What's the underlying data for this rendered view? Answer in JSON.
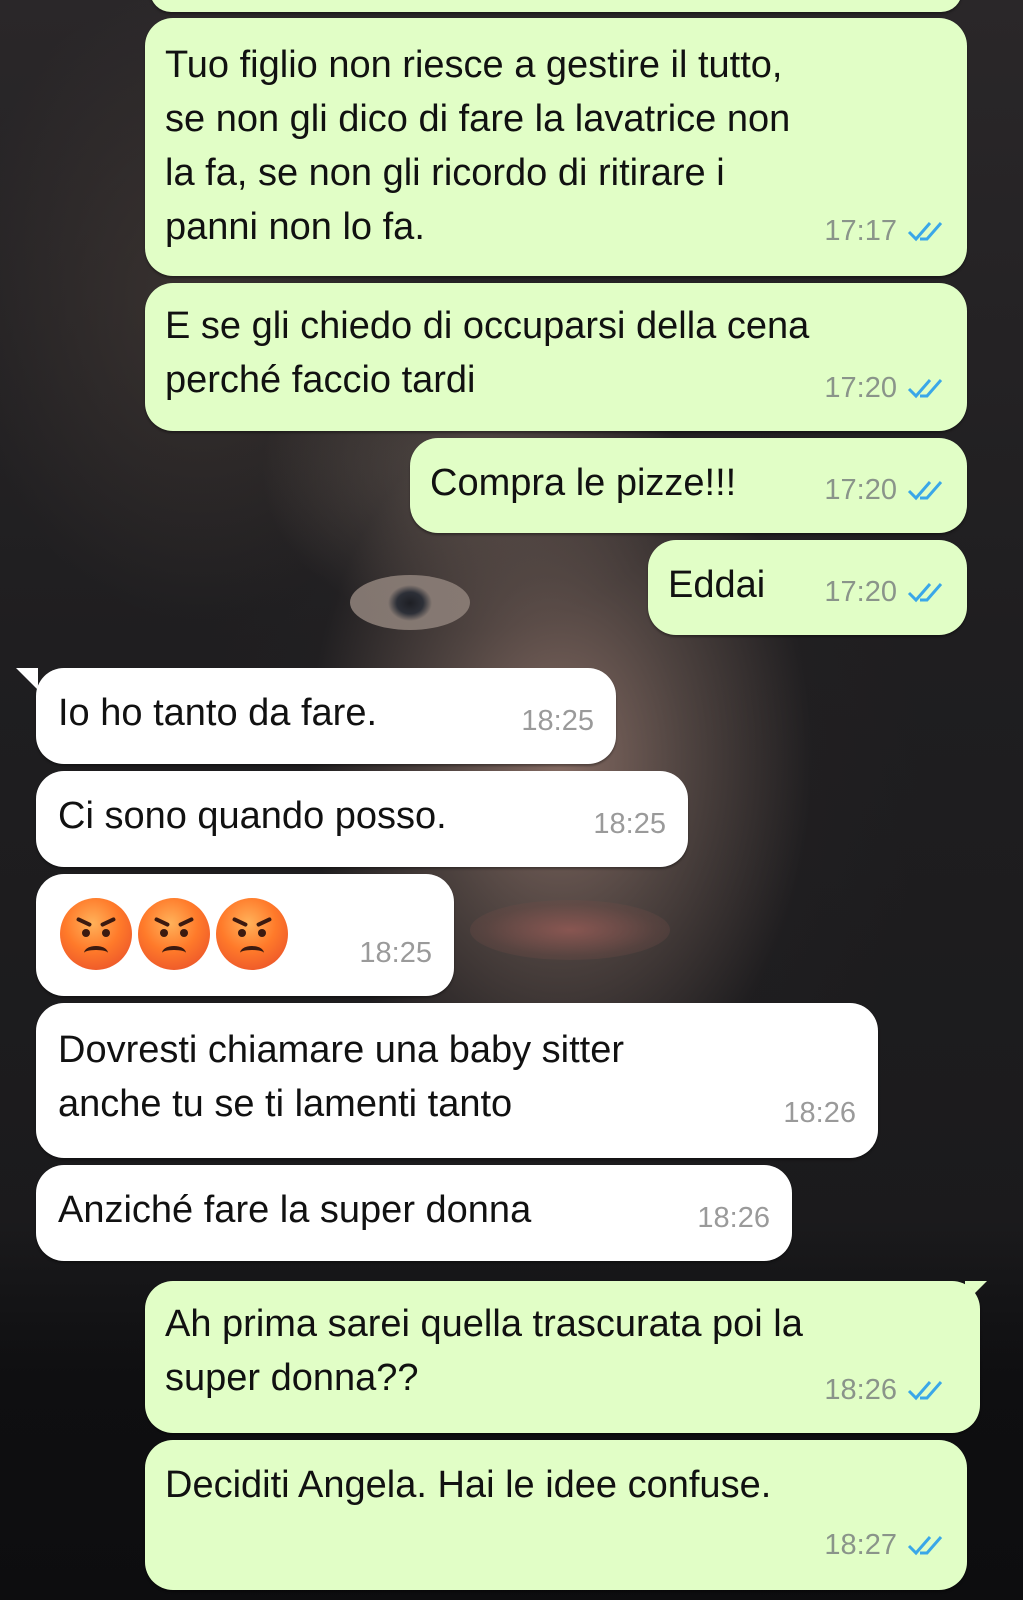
{
  "messages": [
    {
      "side": "out",
      "text": "Tuo figlio non riesce a gestire il tutto,\nse non gli dico di fare la lavatrice non\nla fa, se non gli ricordo di ritirare i\npanni non lo fa.",
      "time": "17:17",
      "read": true
    },
    {
      "side": "out",
      "text": "E se gli chiedo di occuparsi della cena\nperché faccio tardi",
      "time": "17:20",
      "read": true
    },
    {
      "side": "out",
      "text": "Compra le pizze!!!",
      "time": "17:20",
      "read": true
    },
    {
      "side": "out",
      "text": "Eddai",
      "time": "17:20",
      "read": true
    },
    {
      "side": "in",
      "text": "Io ho tanto da fare.",
      "time": "18:25"
    },
    {
      "side": "in",
      "text": "Ci sono quando posso.",
      "time": "18:25"
    },
    {
      "side": "in",
      "emoji": [
        "angry-face-icon",
        "angry-face-icon",
        "angry-face-icon"
      ],
      "time": "18:25"
    },
    {
      "side": "in",
      "text": "Dovresti chiamare una baby sitter\nanche tu se ti lamenti tanto",
      "time": "18:26"
    },
    {
      "side": "in",
      "text": "Anziché fare la super donna",
      "time": "18:26"
    },
    {
      "side": "out",
      "text": "Ah prima sarei quella trascurata poi la\nsuper donna??",
      "time": "18:26",
      "read": true
    },
    {
      "side": "out",
      "text": "Deciditi Angela. Hai le idee confuse.",
      "time": "18:27",
      "read": true
    }
  ],
  "colors": {
    "outgoing_bubble": "#e1fec6",
    "incoming_bubble": "#ffffff",
    "read_ticks": "#3aa7e8",
    "timestamp": "#8a948a"
  }
}
